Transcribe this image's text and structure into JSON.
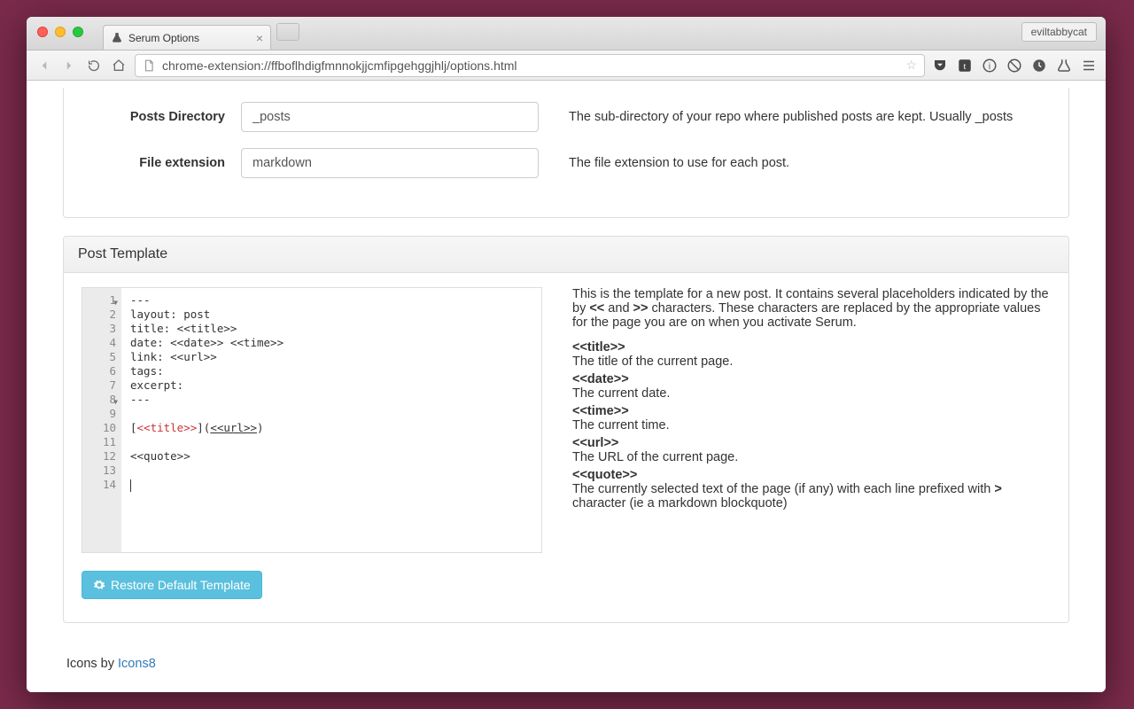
{
  "browser": {
    "tab_title": "Serum Options",
    "profile": "eviltabbycat",
    "url": "chrome-extension://ffboflhdigfmnnokjjcmfipgehggjhlj/options.html"
  },
  "form": {
    "posts_dir": {
      "label": "Posts Directory",
      "value": "_posts",
      "help": "The sub-directory of your repo where published posts are kept. Usually _posts"
    },
    "ext": {
      "label": "File extension",
      "value": "markdown",
      "help": "The file extension to use for each post."
    }
  },
  "panel2_title": "Post Template",
  "editor_lines": [
    "---",
    "layout: post",
    "title: <<title>>",
    "date: <<date>> <<time>>",
    "link: <<url>>",
    "tags:",
    "excerpt:",
    "---",
    "",
    "[<<title>>](<<url>>)",
    "",
    "<<quote>>",
    "",
    ""
  ],
  "template_doc": {
    "intro_a": "This is the template for a new post. It contains several placeholders indicated by the by ",
    "intro_b": " and ",
    "intro_c": " characters. These characters are replaced by the appropriate values for the page you are on when you activate Serum.",
    "open": "<<",
    "close": ">>",
    "items": [
      {
        "k": "<<title>>",
        "v": "The title of the current page."
      },
      {
        "k": "<<date>>",
        "v": "The current date."
      },
      {
        "k": "<<time>>",
        "v": "The current time."
      },
      {
        "k": "<<url>>",
        "v": "The URL of the current page."
      }
    ],
    "quote_k": "<<quote>>",
    "quote_a": "The currently selected text of the page (if any) with each line prefixed with ",
    "quote_sym": ">",
    "quote_b": " character (ie a markdown blockquote)"
  },
  "restore_btn": "Restore Default Template",
  "footer": {
    "text": "Icons by ",
    "link": "Icons8"
  }
}
